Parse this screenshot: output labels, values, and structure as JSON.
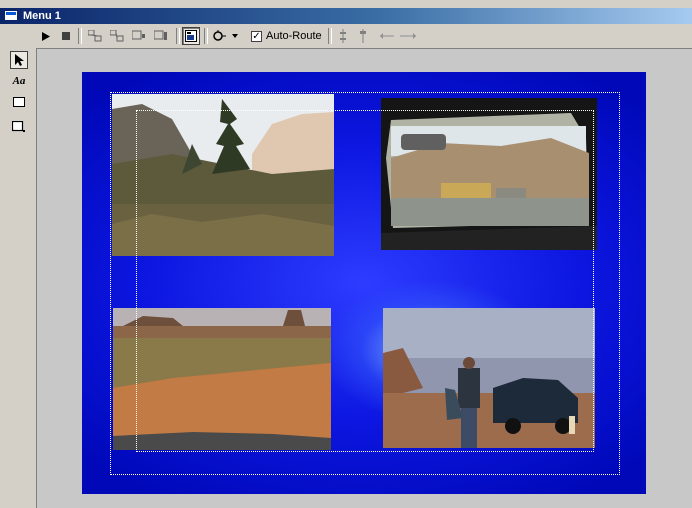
{
  "window": {
    "title": "Menu 1"
  },
  "toolbar": {
    "auto_route_label": "Auto-Route",
    "auto_route_checked": "✓",
    "buttons": [
      "play-icon",
      "stop-icon",
      "link-icon",
      "link-icon",
      "link-icon",
      "link-icon",
      "display-icon",
      "route-icon",
      "dropdown-arrow-icon",
      "align-icon",
      "align-icon",
      "spacing-icon"
    ]
  },
  "palette": {
    "tools": [
      "arrow-select-icon",
      "text-tool-icon",
      "rectangle-tool-icon",
      "button-tool-icon"
    ],
    "text_tool_label": "Aa"
  },
  "canvas": {
    "thumbnails": [
      "forest-canyon-scene",
      "car-windshield-scene",
      "red-desert-road-scene",
      "man-by-truck-scene"
    ],
    "colors": {
      "menu_background": "#0c16e0",
      "safe_area_border": "#ffffff"
    }
  }
}
